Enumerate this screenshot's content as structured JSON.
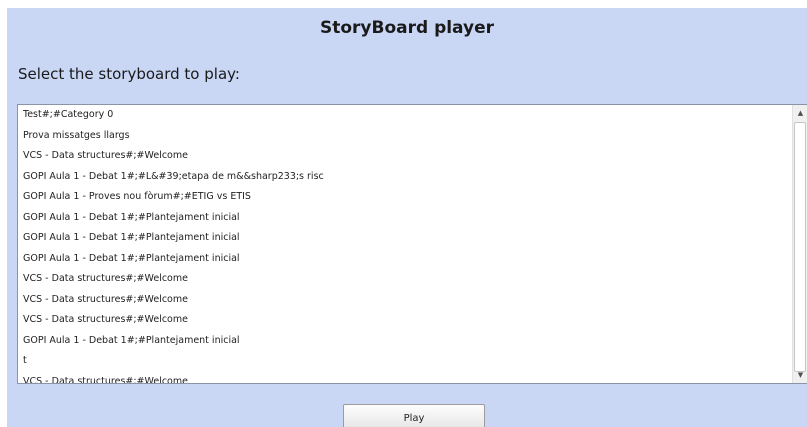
{
  "header": {
    "title": "StoryBoard player"
  },
  "main": {
    "prompt": "Select the storyboard to play:",
    "storyboards": [
      "Test#;#Category 0",
      "Prova missatges llargs",
      "VCS - Data structures#;#Welcome",
      "GOPI Aula 1 - Debat 1#;#L&#39;etapa de m&&sharp233;s risc",
      "GOPI Aula 1 - Proves nou fòrum#;#ETIG vs ETIS",
      "GOPI Aula 1 - Debat 1#;#Plantejament inicial",
      "GOPI Aula 1 - Debat 1#;#Plantejament inicial",
      "GOPI Aula 1 - Debat 1#;#Plantejament inicial",
      "VCS - Data structures#;#Welcome",
      "VCS - Data structures#;#Welcome",
      "VCS - Data structures#;#Welcome",
      "GOPI Aula 1 - Debat 1#;#Plantejament inicial",
      "t",
      "VCS - Data structures#;#Welcome"
    ],
    "scrollbar": {
      "up_icon": "arrow-up-icon",
      "down_icon": "arrow-down-icon"
    },
    "play_label": "Play"
  },
  "colors": {
    "panel_background": "#c9d7f5",
    "list_background": "#ffffff"
  }
}
